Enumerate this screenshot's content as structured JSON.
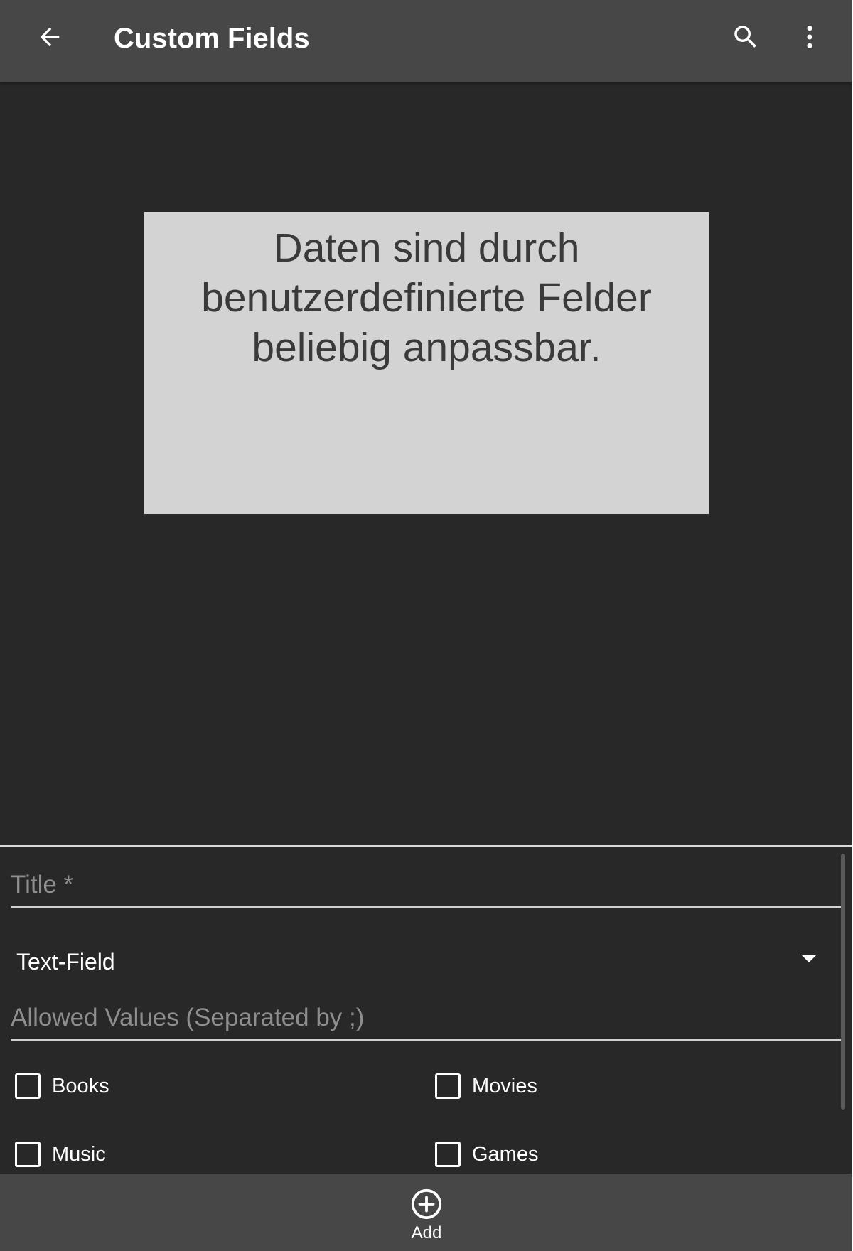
{
  "header": {
    "title": "Custom Fields",
    "back_icon": "arrow-left-icon",
    "search_icon": "search-icon",
    "more_icon": "more-vertical-icon"
  },
  "image": {
    "text": "Daten sind durch benutzerdefinierte Felder beliebig anpassbar."
  },
  "form": {
    "title_field": {
      "placeholder": "Title *",
      "value": ""
    },
    "type_select": {
      "value": "Text-Field"
    },
    "allowed_values_field": {
      "placeholder": "Allowed Values (Separated by ;)",
      "value": ""
    },
    "checkboxes": [
      {
        "label": "Books",
        "checked": false
      },
      {
        "label": "Movies",
        "checked": false
      },
      {
        "label": "Music",
        "checked": false
      },
      {
        "label": "Games",
        "checked": false
      }
    ]
  },
  "footer": {
    "add_label": "Add",
    "add_icon": "add-circle-icon"
  },
  "colors": {
    "app_bar": "#474747",
    "background": "#282828",
    "image_box": "#d3d3d3",
    "image_text": "#3a3a3a",
    "placeholder": "#8e8e8e"
  }
}
